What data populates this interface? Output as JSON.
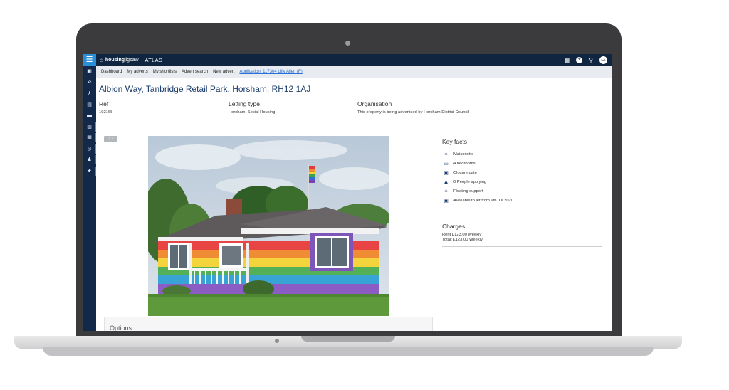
{
  "app": {
    "brand_bold": "housing",
    "brand_light": "jigsaw",
    "product": "ATLAS",
    "user_initials": "LA"
  },
  "topbar_icons": [
    "grid-icon",
    "help-icon",
    "search-icon",
    "avatar"
  ],
  "leftnav": {
    "items": [
      {
        "icon": "id-card-icon",
        "glyph": "▣",
        "accent": ""
      },
      {
        "icon": "undo-icon",
        "glyph": "↶",
        "accent": ""
      },
      {
        "icon": "key-icon",
        "glyph": "⚷",
        "accent": ""
      },
      {
        "icon": "document-icon",
        "glyph": "▤",
        "accent": ""
      },
      {
        "icon": "car-icon",
        "glyph": "▬",
        "accent": ""
      },
      {
        "icon": "building-icon",
        "glyph": "▥",
        "accent": "#3cb371"
      },
      {
        "icon": "chart-icon",
        "glyph": "▦",
        "accent": "#3cb371"
      },
      {
        "icon": "target-icon",
        "glyph": "◎",
        "accent": "#20b2aa"
      },
      {
        "icon": "users-icon",
        "glyph": "♟",
        "accent": "#8e44ad"
      },
      {
        "icon": "star-icon",
        "glyph": "★",
        "accent": "#e83e8c"
      }
    ]
  },
  "subnav": {
    "items": [
      "Dashboard",
      "My adverts",
      "My shortlists",
      "Advert search",
      "New advert"
    ],
    "application_link": "Application: 117304 Lilly Allen (F)"
  },
  "property": {
    "title": "Albion Way, Tanbridge Retail Park, Horsham, RH12 1AJ",
    "ref_label": "Ref",
    "ref_value": "192168",
    "letting_label": "Letting type",
    "letting_value": "Horsham: Social Housing",
    "org_label": "Organisation",
    "org_value": "This property is being advertised by Horsham District Council",
    "photo_count": "1"
  },
  "key_facts": {
    "heading": "Key facts",
    "items": [
      {
        "icon": "house-icon",
        "glyph": "⌂",
        "label": "Maisonette"
      },
      {
        "icon": "bed-icon",
        "glyph": "▭",
        "label": "4 bedrooms"
      },
      {
        "icon": "calendar-icon",
        "glyph": "▣",
        "label": "Closure date"
      },
      {
        "icon": "people-icon",
        "glyph": "♟",
        "label": "0 People applying"
      },
      {
        "icon": "home-support-icon",
        "glyph": "⌂",
        "label": "Floating support"
      },
      {
        "icon": "calendar-icon",
        "glyph": "▣",
        "label": "Available to let from 9th Jul 2020"
      }
    ]
  },
  "charges": {
    "heading": "Charges",
    "rent": "Rent £123.00 Weekly",
    "total": "Total: £123.00 Weekly"
  },
  "options": {
    "heading": "Options"
  }
}
